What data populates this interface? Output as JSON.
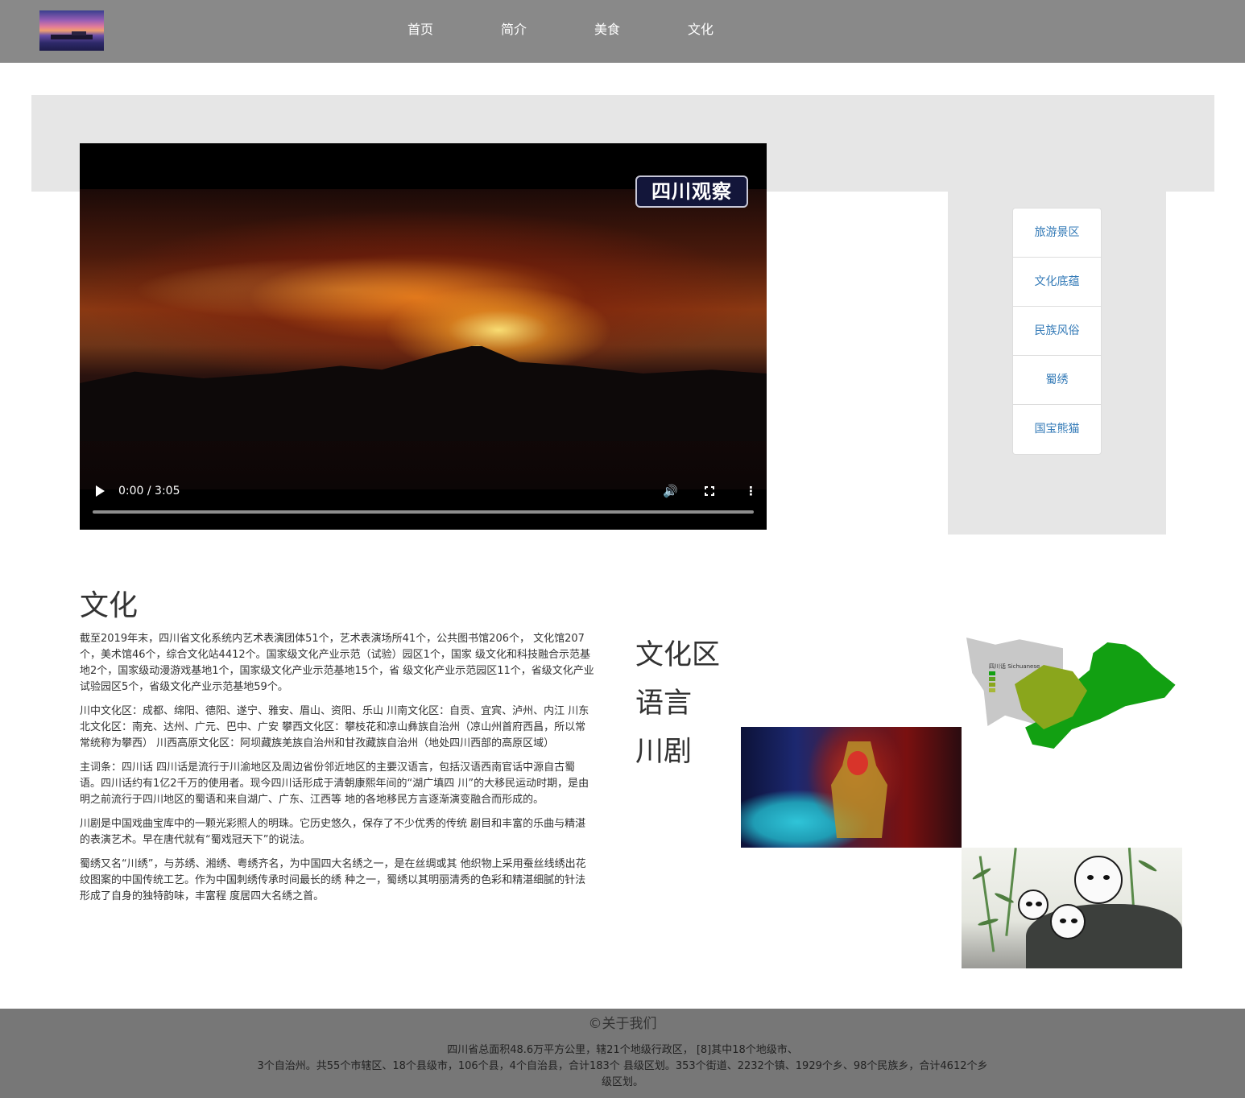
{
  "nav": {
    "links": [
      "首页",
      "简介",
      "美食",
      "文化"
    ]
  },
  "video": {
    "badge": "四川观察",
    "time": "0:00 / 3:05",
    "progress": 0
  },
  "side_menu": {
    "items": [
      "旅游景区",
      "文化底蕴",
      "民族风俗",
      "蜀绣",
      "国宝熊猫"
    ]
  },
  "culture": {
    "title": "文化",
    "paragraphs": [
      "截至2019年末，四川省文化系统内艺术表演团体51个，艺术表演场所41个，公共图书馆206个， 文化馆207个，美术馆46个，综合文化站4412个。国家级文化产业示范（试验）园区1个，国家 级文化和科技融合示范基地2个，国家级动漫游戏基地1个，国家级文化产业示范基地15个，省 级文化产业示范园区11个，省级文化产业试验园区5个，省级文化产业示范基地59个。",
      "川中文化区：成都、绵阳、德阳、遂宁、雅安、眉山、资阳、乐山 川南文化区：自贡、宜宾、泸州、内江 川东北文化区：南充、达州、广元、巴中、广安 攀西文化区：攀枝花和凉山彝族自治州（凉山州首府西昌，所以常常统称为攀西） 川西高原文化区：阿坝藏族羌族自治州和甘孜藏族自治州（地处四川西部的高原区域）",
      "主词条：四川话 四川话是流行于川渝地区及周边省份邻近地区的主要汉语言，包括汉语西南官话中源自古蜀语。四川话约有1亿2千万的使用者。现今四川话形成于清朝康熙年间的“湖广填四 川”的大移民运动时期，是由明之前流行于四川地区的蜀语和来自湖广、广东、江西等 地的各地移民方言逐渐演变融合而形成的。",
      "川剧是中国戏曲宝库中的一颗光彩照人的明珠。它历史悠久，保存了不少优秀的传统 剧目和丰富的乐曲与精湛的表演艺术。早在唐代就有“蜀戏冠天下”的说法。",
      "蜀绣又名“川绣”，与苏绣、湘绣、粤绣齐名，为中国四大名绣之一，是在丝绸或其 他织物上采用蚕丝线绣出花纹图案的中国传统工艺。作为中国刺绣传承时间最长的绣 种之一，蜀绣以其明丽清秀的色彩和精湛细腻的针法形成了自身的独特韵味，丰富程 度居四大名绣之首。"
    ],
    "topics": [
      "文化区",
      "语言",
      "川剧"
    ],
    "map_legend_title": "四川话 Sichuanese"
  },
  "footer": {
    "title": "©关于我们",
    "lines": [
      "四川省总面积48.6万平方公里，辖21个地级行政区， [8]其中18个地级市、",
      "3个自治州。共55个市辖区、18个县级市，106个县，4个自治县，合计183个 县级区划。353个街道、2232个镇、1929个乡、98个民族乡，合计4612个乡",
      "级区划。"
    ]
  },
  "colors": {
    "topbar": "#898989",
    "banner": "#e6e6e6",
    "link": "#337ab7",
    "footer": "#777777"
  }
}
